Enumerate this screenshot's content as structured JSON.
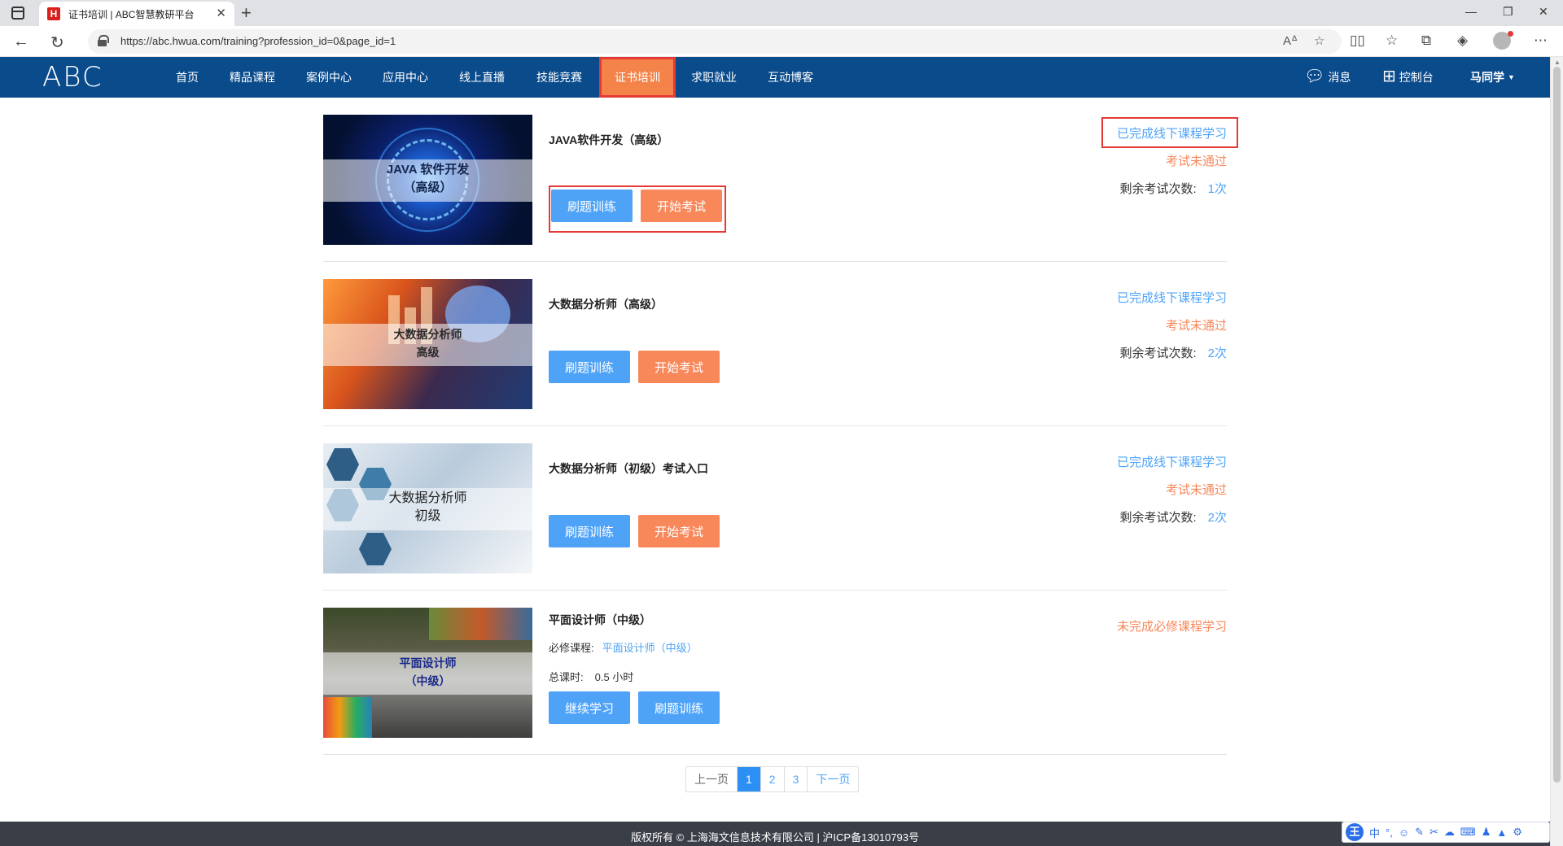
{
  "browser": {
    "tab_title": "证书培训 | ABC智慧教研平台",
    "tab_favicon": "H",
    "url": "https://abc.hwua.com/training?profession_id=0&page_id=1"
  },
  "header": {
    "logo": "ABC",
    "nav": [
      "首页",
      "精品课程",
      "案例中心",
      "应用中心",
      "线上直播",
      "技能竞赛",
      "证书培训",
      "求职就业",
      "互动博客"
    ],
    "active_nav": "证书培训",
    "messages": "消息",
    "console": "控制台",
    "user": "马同学"
  },
  "courses": [
    {
      "thumb_lines": [
        "JAVA 软件开发",
        "（高级）"
      ],
      "title": "JAVA软件开发（高级）",
      "buttons": [
        "刷题训练",
        "开始考试"
      ],
      "status_done": "已完成线下课程学习",
      "status_exam": "考试未通过",
      "remain_label": "剩余考试次数:",
      "remain_value": "1次"
    },
    {
      "thumb_lines": [
        "大数据分析师",
        "高级"
      ],
      "title": "大数据分析师（高级）",
      "buttons": [
        "刷题训练",
        "开始考试"
      ],
      "status_done": "已完成线下课程学习",
      "status_exam": "考试未通过",
      "remain_label": "剩余考试次数:",
      "remain_value": "2次"
    },
    {
      "thumb_lines": [
        "大数据分析师",
        "初级"
      ],
      "title": "大数据分析师（初级）考试入口",
      "buttons": [
        "刷题训练",
        "开始考试"
      ],
      "status_done": "已完成线下课程学习",
      "status_exam": "考试未通过",
      "remain_label": "剩余考试次数:",
      "remain_value": "2次"
    },
    {
      "thumb_lines": [
        "平面设计师",
        "（中级）"
      ],
      "title": "平面设计师（中级）",
      "required_label": "必修课程:",
      "required_link": "平面设计师（中级）",
      "hours_label": "总课时:",
      "hours_value": "0.5 小时",
      "buttons": [
        "继续学习",
        "刷题训练"
      ],
      "status_pending": "未完成必修课程学习"
    }
  ],
  "pagination": {
    "prev": "上一页",
    "pages": [
      "1",
      "2",
      "3"
    ],
    "current": "1",
    "next": "下一页"
  },
  "footer": {
    "text": "版权所有 © 上海海文信息技术有限公司 | 沪ICP备13010793号"
  },
  "ime": {
    "logo": "王",
    "mode": "中"
  },
  "colors": {
    "nav_bg": "#0a4b8c",
    "active_nav": "#f4834a",
    "blue": "#4fa3f7",
    "orange": "#f8875a",
    "highlight_border": "#e53935"
  }
}
